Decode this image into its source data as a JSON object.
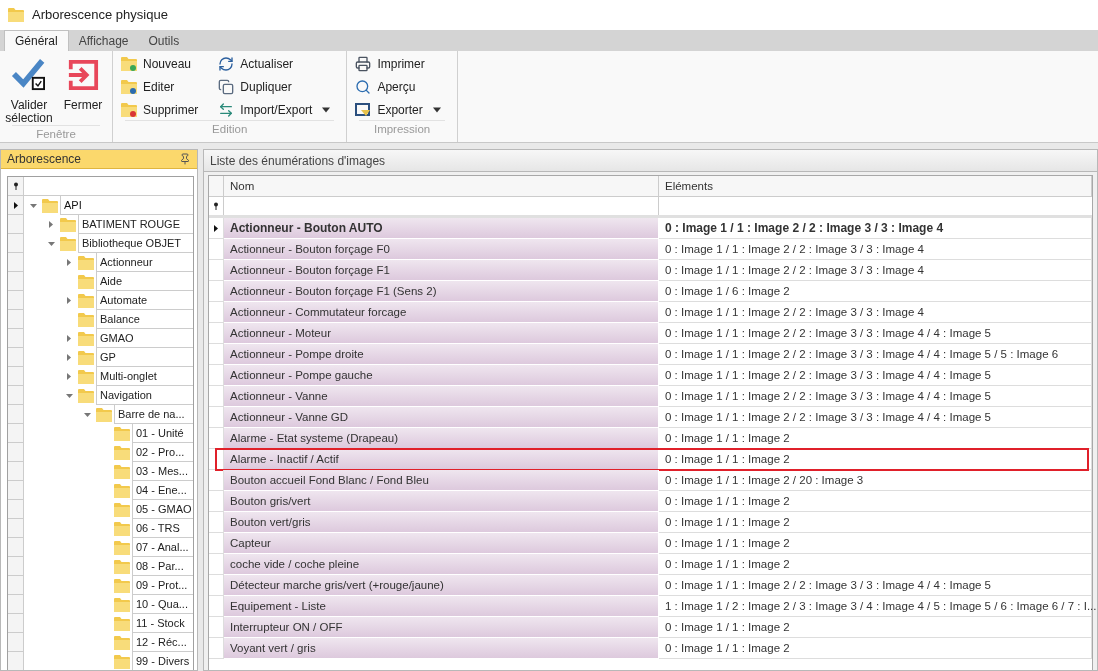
{
  "window": {
    "title": "Arborescence physique"
  },
  "tabs": [
    {
      "label": "Général",
      "selected": true
    },
    {
      "label": "Affichage",
      "selected": false
    },
    {
      "label": "Outils",
      "selected": false
    }
  ],
  "ribbon": [
    {
      "label": "Fenêtre",
      "buttons": [
        {
          "label": "Valider sélection",
          "kind": "large",
          "dropdown": false
        },
        {
          "label": "Fermer",
          "kind": "large",
          "dropdown": false
        }
      ]
    },
    {
      "label": "Edition",
      "buttons": [
        {
          "label": "Nouveau",
          "kind": "small",
          "dropdown": false
        },
        {
          "label": "Editer",
          "kind": "small",
          "dropdown": false
        },
        {
          "label": "Supprimer",
          "kind": "small",
          "dropdown": false
        },
        {
          "label": "Actualiser",
          "kind": "small",
          "dropdown": false
        },
        {
          "label": "Dupliquer",
          "kind": "small",
          "dropdown": false
        },
        {
          "label": "Import/Export",
          "kind": "small",
          "dropdown": true
        }
      ]
    },
    {
      "label": "Impression",
      "buttons": [
        {
          "label": "Imprimer",
          "kind": "small",
          "dropdown": false
        },
        {
          "label": "Aperçu",
          "kind": "small",
          "dropdown": false
        },
        {
          "label": "Exporter",
          "kind": "small",
          "dropdown": true
        }
      ]
    }
  ],
  "tree_panel": {
    "title": "Arborescence",
    "nodes": [
      {
        "label": "API",
        "kind": "branch",
        "expanded": true,
        "selected": true,
        "children": [
          {
            "label": "BATIMENT ROUGE",
            "kind": "branch",
            "expanded": false,
            "selected": false
          },
          {
            "label": "Bibliotheque OBJET",
            "kind": "branch",
            "expanded": true,
            "selected": false,
            "children": [
              {
                "label": "Actionneur",
                "kind": "branch",
                "expanded": false,
                "selected": false
              },
              {
                "label": "Aide",
                "kind": "leaf",
                "selected": false
              },
              {
                "label": "Automate",
                "kind": "branch",
                "expanded": false,
                "selected": false
              },
              {
                "label": "Balance",
                "kind": "leaf",
                "selected": false
              },
              {
                "label": "GMAO",
                "kind": "branch",
                "expanded": false,
                "selected": false
              },
              {
                "label": "GP",
                "kind": "branch",
                "expanded": false,
                "selected": false
              },
              {
                "label": "Multi-onglet",
                "kind": "branch",
                "expanded": false,
                "selected": false
              },
              {
                "label": "Navigation",
                "kind": "branch",
                "expanded": true,
                "selected": false,
                "children": [
                  {
                    "label": "Barre de na...",
                    "kind": "branch",
                    "expanded": true,
                    "selected": false,
                    "children": [
                      {
                        "label": "01 - Unité",
                        "kind": "leaf",
                        "selected": false
                      },
                      {
                        "label": "02 - Pro...",
                        "kind": "leaf",
                        "selected": false
                      },
                      {
                        "label": "03 - Mes...",
                        "kind": "leaf",
                        "selected": false
                      },
                      {
                        "label": "04 - Ene...",
                        "kind": "leaf",
                        "selected": false
                      },
                      {
                        "label": "05 - GMAO",
                        "kind": "leaf",
                        "selected": false
                      },
                      {
                        "label": "06 - TRS",
                        "kind": "leaf",
                        "selected": false
                      },
                      {
                        "label": "07 - Anal...",
                        "kind": "leaf",
                        "selected": false
                      },
                      {
                        "label": "08 - Par...",
                        "kind": "leaf",
                        "selected": false
                      },
                      {
                        "label": "09 - Prot...",
                        "kind": "leaf",
                        "selected": false
                      },
                      {
                        "label": "10 - Qua...",
                        "kind": "leaf",
                        "selected": false
                      },
                      {
                        "label": "11 - Stock",
                        "kind": "leaf",
                        "selected": false
                      },
                      {
                        "label": "12 - Réc...",
                        "kind": "leaf",
                        "selected": false
                      },
                      {
                        "label": "99 - Divers",
                        "kind": "leaf",
                        "selected": false
                      }
                    ]
                  }
                ]
              }
            ]
          }
        ]
      }
    ]
  },
  "list_panel": {
    "title": "Liste des énumérations d'images",
    "columns": [
      "Nom",
      "Eléments"
    ],
    "rows": [
      {
        "name": "Actionneur - Bouton AUTO",
        "elements": "0 : Image 1 / 1 : Image 2 / 2 : Image 3 / 3 : Image 4",
        "selected": true,
        "highlighted": false
      },
      {
        "name": "Actionneur - Bouton forçage F0",
        "elements": "0 : Image 1 / 1 : Image 2 / 2 : Image 3 / 3 : Image 4",
        "selected": false,
        "highlighted": false
      },
      {
        "name": "Actionneur - Bouton forçage F1",
        "elements": "0 : Image 1 / 1 : Image 2 / 2 : Image 3 / 3 : Image 4",
        "selected": false,
        "highlighted": false
      },
      {
        "name": "Actionneur - Bouton forçage F1 (Sens 2)",
        "elements": "0 : Image 1 / 6 : Image 2",
        "selected": false,
        "highlighted": false
      },
      {
        "name": "Actionneur - Commutateur forcage",
        "elements": "0 : Image 1 / 1 : Image 2 / 2 : Image 3 / 3 : Image 4",
        "selected": false,
        "highlighted": false
      },
      {
        "name": "Actionneur - Moteur",
        "elements": "0 : Image 1 / 1 : Image 2 / 2 : Image 3 / 3 : Image 4 / 4 : Image 5",
        "selected": false,
        "highlighted": false
      },
      {
        "name": "Actionneur - Pompe droite",
        "elements": "0 : Image 1 / 1 : Image 2 / 2 : Image 3 / 3 : Image 4 / 4 : Image 5 / 5 : Image 6",
        "selected": false,
        "highlighted": false
      },
      {
        "name": "Actionneur - Pompe gauche",
        "elements": "0 : Image 1 / 1 : Image 2 / 2 : Image 3 / 3 : Image 4 / 4 : Image 5",
        "selected": false,
        "highlighted": false
      },
      {
        "name": "Actionneur - Vanne",
        "elements": "0 : Image 1 / 1 : Image 2 / 2 : Image 3 / 3 : Image 4 / 4 : Image 5",
        "selected": false,
        "highlighted": false
      },
      {
        "name": "Actionneur - Vanne GD",
        "elements": "0 : Image 1 / 1 : Image 2 / 2 : Image 3 / 3 : Image 4 / 4 : Image 5",
        "selected": false,
        "highlighted": false
      },
      {
        "name": "Alarme - Etat systeme (Drapeau)",
        "elements": "0 : Image 1 / 1 : Image 2",
        "selected": false,
        "highlighted": false
      },
      {
        "name": "Alarme - Inactif / Actif",
        "elements": "0 : Image 1 / 1 : Image 2",
        "selected": false,
        "highlighted": true
      },
      {
        "name": "Bouton accueil Fond Blanc / Fond Bleu",
        "elements": "0 : Image 1 / 1 : Image 2 / 20 : Image 3",
        "selected": false,
        "highlighted": false
      },
      {
        "name": "Bouton gris/vert",
        "elements": "0 : Image 1 / 1 : Image 2",
        "selected": false,
        "highlighted": false
      },
      {
        "name": "Bouton vert/gris",
        "elements": "0 : Image 1 / 1 : Image 2",
        "selected": false,
        "highlighted": false
      },
      {
        "name": "Capteur",
        "elements": "0 : Image 1 / 1 : Image 2",
        "selected": false,
        "highlighted": false
      },
      {
        "name": "coche vide / coche pleine",
        "elements": "0 : Image 1 / 1 : Image 2",
        "selected": false,
        "highlighted": false
      },
      {
        "name": "Détecteur marche gris/vert (+rouge/jaune)",
        "elements": "0 : Image 1 / 1 : Image 2 / 2 : Image 3 / 3 : Image 4 / 4 : Image 5",
        "selected": false,
        "highlighted": false
      },
      {
        "name": "Equipement - Liste",
        "elements": "1 : Image 1 / 2 : Image 2 / 3 : Image 3 / 4 : Image 4 / 5 : Image 5 / 6 : Image 6 / 7 : I...",
        "selected": false,
        "highlighted": false
      },
      {
        "name": "Interrupteur ON / OFF",
        "elements": "0 : Image 1 / 1 : Image 2",
        "selected": false,
        "highlighted": false
      },
      {
        "name": "Voyant vert / gris",
        "elements": "0 : Image 1 / 1 : Image 2",
        "selected": false,
        "highlighted": false
      }
    ]
  }
}
